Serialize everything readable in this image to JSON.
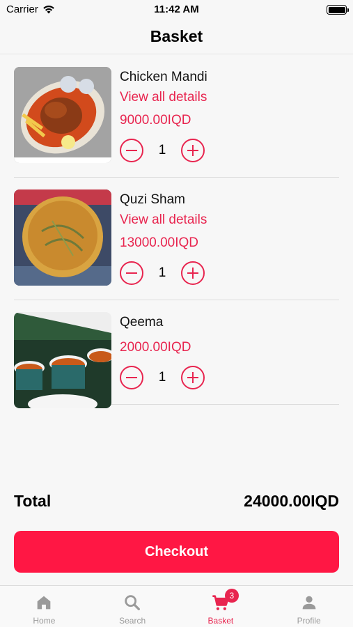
{
  "status": {
    "carrier": "Carrier",
    "time": "11:42 AM"
  },
  "header": {
    "title": "Basket"
  },
  "items": [
    {
      "name": "Chicken Mandi",
      "link": "View all details",
      "price": "9000.00IQD",
      "qty": "1"
    },
    {
      "name": "Quzi Sham",
      "link": "View all details",
      "price": "13000.00IQD",
      "qty": "1"
    },
    {
      "name": "Qeema",
      "price": "2000.00IQD",
      "qty": "1"
    }
  ],
  "total": {
    "label": "Total",
    "value": "24000.00IQD"
  },
  "checkout": {
    "label": "Checkout"
  },
  "tabs": [
    {
      "label": "Home",
      "icon": "home-icon"
    },
    {
      "label": "Search",
      "icon": "search-icon"
    },
    {
      "label": "Basket",
      "icon": "cart-icon",
      "badge": "3",
      "active": true
    },
    {
      "label": "Profile",
      "icon": "person-icon"
    }
  ],
  "colors": {
    "accent": "#e8254f",
    "button": "#ff1744",
    "inactive": "#9a9a9a"
  }
}
